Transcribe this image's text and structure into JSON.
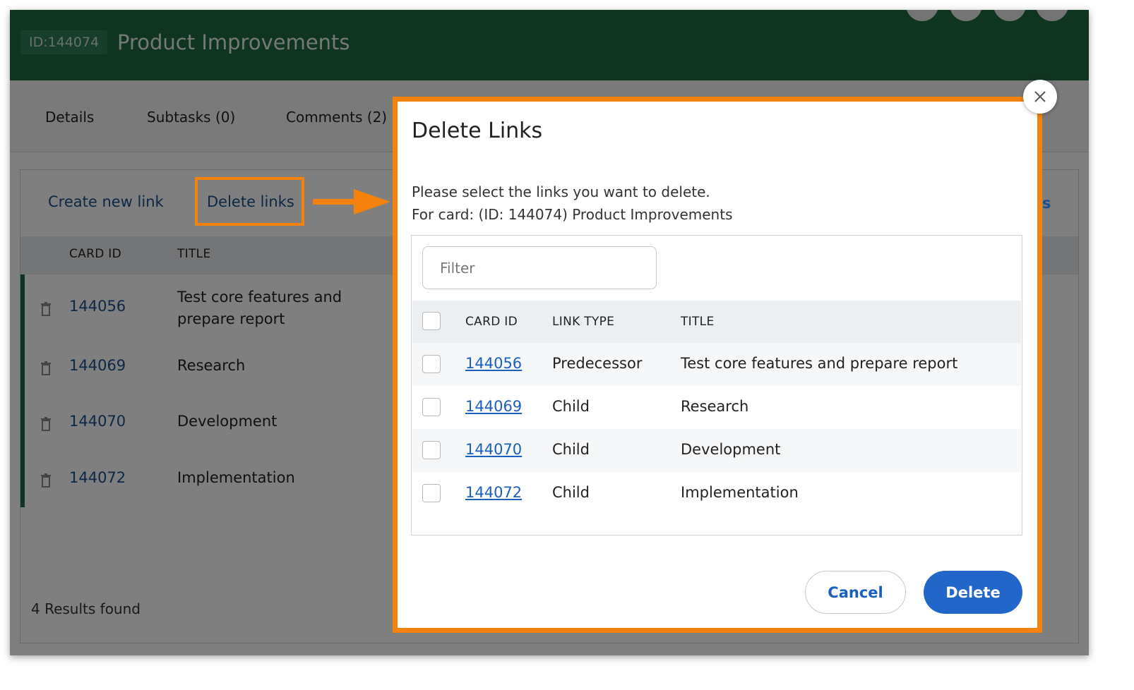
{
  "header": {
    "id_badge": "ID:144074",
    "title": "Product Improvements"
  },
  "tabs": [
    {
      "label": "Details"
    },
    {
      "label": "Subtasks (0)"
    },
    {
      "label": "Comments (2)"
    }
  ],
  "links_panel": {
    "create_label": "Create new link",
    "delete_label": "Delete links",
    "partial_right_label": "s",
    "columns": {
      "card_id": "CARD ID",
      "title": "TITLE"
    },
    "rows": [
      {
        "id": "144056",
        "title": "Test core features and prepare report"
      },
      {
        "id": "144069",
        "title": "Research"
      },
      {
        "id": "144070",
        "title": "Development"
      },
      {
        "id": "144072",
        "title": "Implementation"
      }
    ],
    "results": "4 Results found"
  },
  "modal": {
    "title": "Delete Links",
    "instruction": "Please select the links you want to delete.",
    "for_card": "For card: (ID: 144074) Product Improvements",
    "filter_placeholder": "Filter",
    "columns": {
      "card_id": "CARD ID",
      "link_type": "LINK TYPE",
      "title": "TITLE"
    },
    "rows": [
      {
        "id": "144056",
        "type": "Predecessor",
        "title": "Test core features and prepare report"
      },
      {
        "id": "144069",
        "type": "Child",
        "title": "Research"
      },
      {
        "id": "144070",
        "type": "Child",
        "title": "Development"
      },
      {
        "id": "144072",
        "type": "Child",
        "title": "Implementation"
      }
    ],
    "cancel_label": "Cancel",
    "delete_label": "Delete"
  },
  "colors": {
    "header_green": "#1e6b43",
    "highlight_orange": "#f5820d",
    "primary_blue": "#2166c8",
    "link_blue": "#1b5fbf"
  }
}
